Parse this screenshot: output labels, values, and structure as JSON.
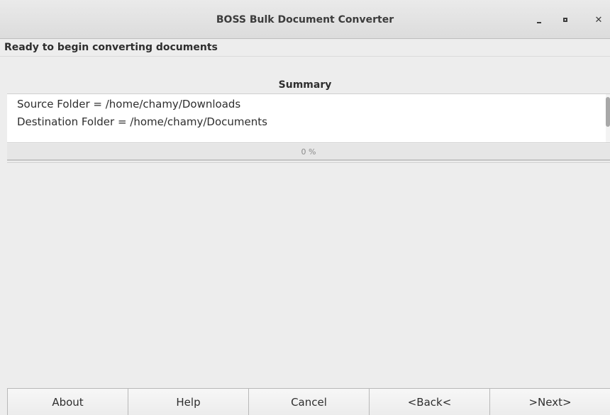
{
  "window": {
    "title": "BOSS Bulk Document Converter",
    "minimize_icon": "minimize-icon",
    "maximize_icon": "maximize-icon",
    "close_icon": "close-icon"
  },
  "status": {
    "text": "Ready to begin converting documents"
  },
  "summary": {
    "title": "Summary",
    "lines": [
      "Source Folder = /home/chamy/Downloads",
      "Destination Folder = /home/chamy/Documents"
    ]
  },
  "progress": {
    "value": 0,
    "text": "0 %"
  },
  "buttons": {
    "about": "About",
    "help": "Help",
    "cancel": "Cancel",
    "back": "<Back<",
    "next": ">Next>"
  }
}
